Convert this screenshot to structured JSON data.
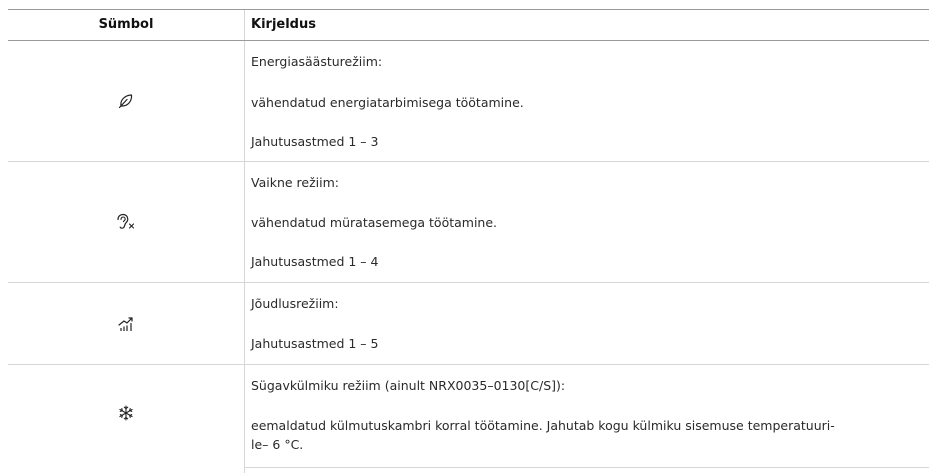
{
  "table": {
    "headers": {
      "symbol": "Sümbol",
      "description": "Kirjeldus"
    },
    "rows": [
      {
        "icon": "leaf-icon",
        "lines": [
          "Energiasäästurežiim:",
          "vähendatud energiatarbimisega töötamine.",
          "Jahutusastmed 1 – 3"
        ]
      },
      {
        "icon": "ear-muted-icon",
        "lines": [
          "Vaikne režiim:",
          "vähendatud müratasemega töötamine.",
          "Jahutusastmed 1 – 4"
        ]
      },
      {
        "icon": "performance-chart-icon",
        "lines": [
          "Jõudlusrežiim:",
          "Jahutusastmed 1 – 5"
        ]
      },
      {
        "icon": "snowflake-icon",
        "lines": [
          "Sügavkülmiku režiim (ainult NRX0035–0130[C/S]):",
          "eemaldatud külmutuskambri korral töötamine.  Jahutab kogu külmiku sisemuse temperatuuri-",
          "le– 6 °C."
        ]
      }
    ]
  }
}
